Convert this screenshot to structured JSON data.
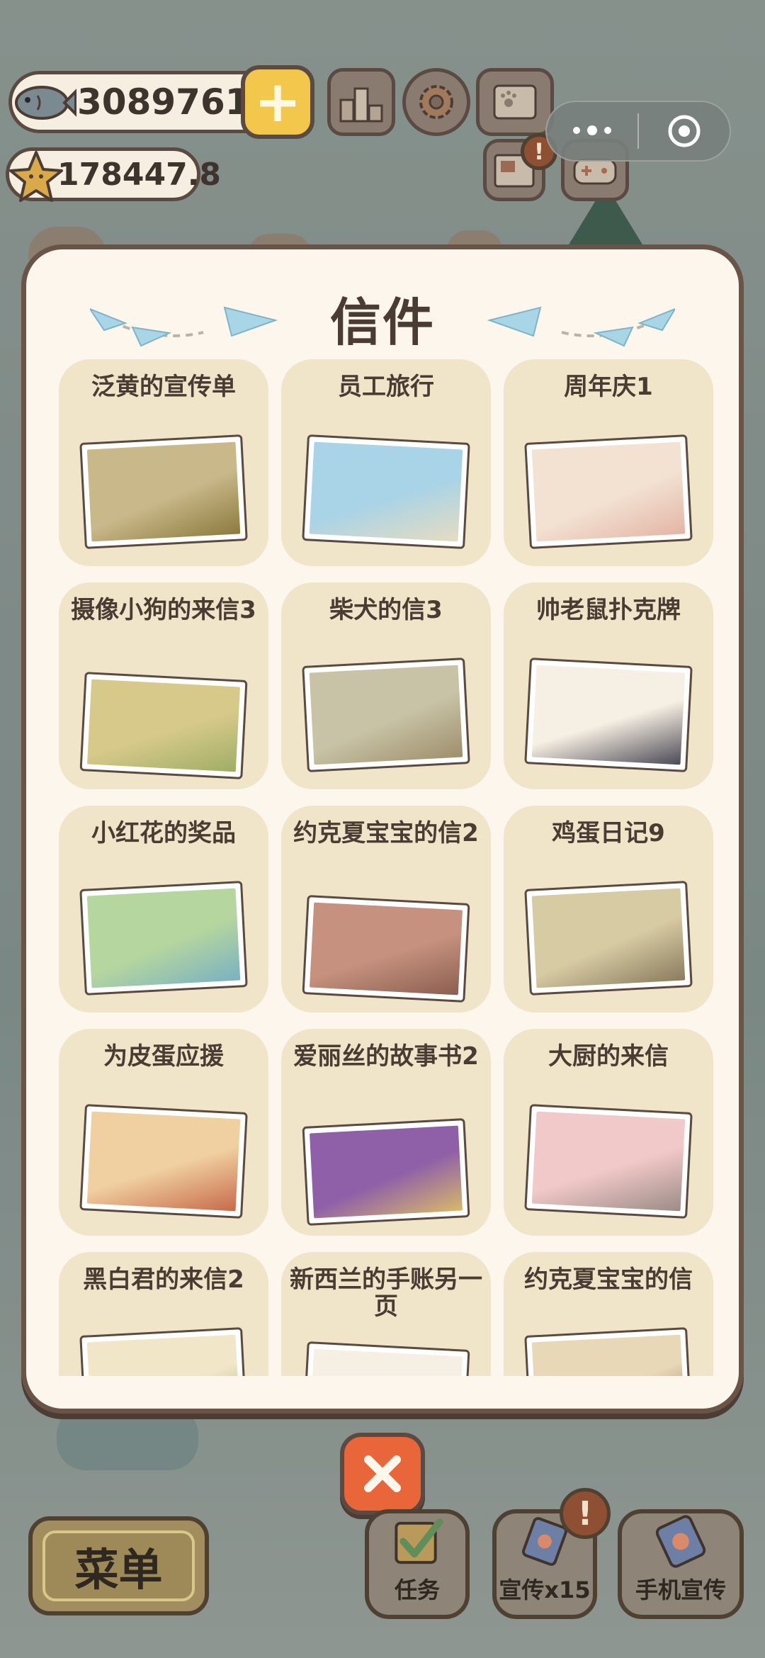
{
  "hud": {
    "fish_count": "30897616",
    "star_count": "178447.8",
    "plus_label": "+"
  },
  "modal": {
    "title": "信件",
    "letters": [
      {
        "label": "泛黄的宣传单",
        "scene_colors": [
          "#c9b889",
          "#8c7a3f"
        ]
      },
      {
        "label": "员工旅行",
        "scene_colors": [
          "#a9d3e6",
          "#e6dcc2"
        ]
      },
      {
        "label": "周年庆1",
        "scene_colors": [
          "#f3e2d2",
          "#e3b5a6"
        ]
      },
      {
        "label": "摄像小狗的来信3",
        "scene_colors": [
          "#d7c98a",
          "#9eae65"
        ]
      },
      {
        "label": "柴犬的信3",
        "scene_colors": [
          "#c8c2a6",
          "#9e8f6b"
        ]
      },
      {
        "label": "帅老鼠扑克牌",
        "scene_colors": [
          "#f6efe3",
          "#4b4a55"
        ]
      },
      {
        "label": "小红花的奖品",
        "scene_colors": [
          "#b5d69e",
          "#7ab1c3"
        ]
      },
      {
        "label": "约克夏宝宝的信2",
        "scene_colors": [
          "#c6917e",
          "#8b5e50"
        ]
      },
      {
        "label": "鸡蛋日记9",
        "scene_colors": [
          "#d7cba4",
          "#8a7c5d"
        ]
      },
      {
        "label": "为皮蛋应援",
        "scene_colors": [
          "#f0cfa0",
          "#c76a4a"
        ]
      },
      {
        "label": "爱丽丝的故事书2",
        "scene_colors": [
          "#8f5fa8",
          "#d8b86a"
        ]
      },
      {
        "label": "大厨的来信",
        "scene_colors": [
          "#f2c9c9",
          "#9c8c86"
        ]
      },
      {
        "label": "黑白君的来信2",
        "scene_colors": [
          "#f2e6c9",
          "#a8b36e"
        ]
      },
      {
        "label": "新西兰的手账另一页",
        "scene_colors": [
          "#f6efe3",
          "#9fc6cf"
        ]
      },
      {
        "label": "约克夏宝宝的信",
        "scene_colors": [
          "#e9d8b8",
          "#9c6e4c"
        ]
      }
    ]
  },
  "bottom_bar": {
    "menu_label": "菜单",
    "task_label": "任务",
    "promo_label": "宣传x15",
    "phone_label": "手机宣传",
    "badge_text": "!"
  },
  "colors": {
    "card_bg": "#f1e5c9",
    "modal_bg": "#fdf6ec",
    "outline": "#5b4a42",
    "close_btn": "#e8663a",
    "coin_plus": "#f3c74c"
  },
  "icons": [
    "fish-icon",
    "star-icon",
    "plus-icon",
    "ranking-icon",
    "gear-icon",
    "paw-book-icon",
    "more-dots-icon",
    "target-icon",
    "letter-box-icon",
    "gamepad-icon",
    "paper-plane-icon",
    "close-icon",
    "checkbox-icon",
    "cat-card-icon",
    "phone-promo-icon"
  ]
}
